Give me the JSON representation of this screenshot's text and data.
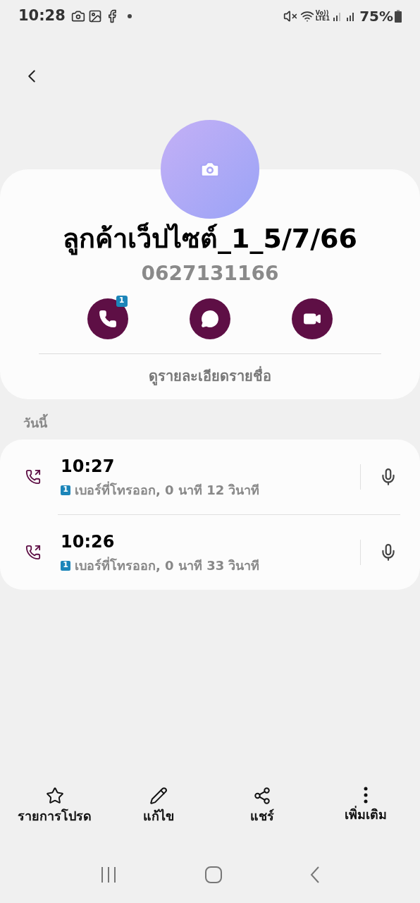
{
  "status_bar": {
    "time": "10:28",
    "network_label_top": "Vo))",
    "network_label_bottom": "LTE1",
    "battery": "75%"
  },
  "contact": {
    "name": "ลูกค้าเว็ปไซต์_1_5/7/66",
    "phone": "0627131166",
    "actions": [
      {
        "kind": "call",
        "badge": "1"
      },
      {
        "kind": "message"
      },
      {
        "kind": "video"
      }
    ],
    "details_link": "ดูรายละเอียดรายชื่อ"
  },
  "history": {
    "heading": "วันนี้",
    "calls": [
      {
        "time": "10:27",
        "sim": "1",
        "description": "เบอร์ที่โทรออก, 0 นาที 12 วินาที"
      },
      {
        "time": "10:26",
        "sim": "1",
        "description": "เบอร์ที่โทรออก, 0 นาที 33 วินาที"
      }
    ]
  },
  "bottom_actions": [
    {
      "kind": "favorite",
      "label": "รายการโปรด"
    },
    {
      "kind": "edit",
      "label": "แก้ไข"
    },
    {
      "kind": "share",
      "label": "แชร์"
    },
    {
      "kind": "more",
      "label": "เพิ่มเติม"
    }
  ]
}
